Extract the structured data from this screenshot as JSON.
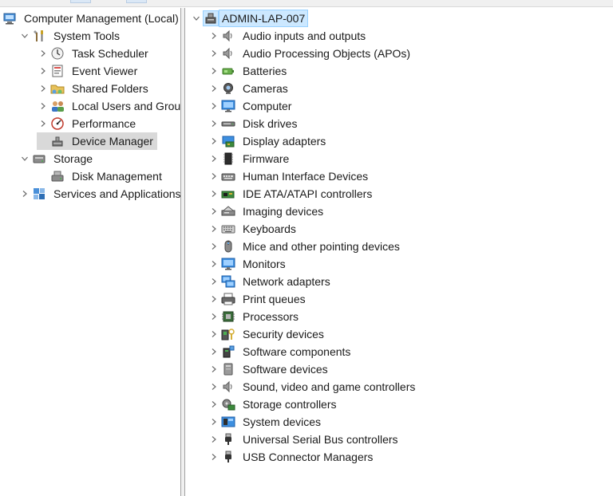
{
  "left_tree": [
    {
      "label": "Computer Management (Local)",
      "icon": "computer-management-icon",
      "depth": 0,
      "chevron": "none",
      "selected": false
    },
    {
      "label": "System Tools",
      "icon": "system-tools-icon",
      "depth": 1,
      "chevron": "down",
      "selected": false
    },
    {
      "label": "Task Scheduler",
      "icon": "clock-icon",
      "depth": 2,
      "chevron": "right",
      "selected": false
    },
    {
      "label": "Event Viewer",
      "icon": "event-log-icon",
      "depth": 2,
      "chevron": "right",
      "selected": false
    },
    {
      "label": "Shared Folders",
      "icon": "shared-folder-icon",
      "depth": 2,
      "chevron": "right",
      "selected": false
    },
    {
      "label": "Local Users and Groups",
      "icon": "users-icon",
      "depth": 2,
      "chevron": "right",
      "selected": false
    },
    {
      "label": "Performance",
      "icon": "performance-icon",
      "depth": 2,
      "chevron": "right",
      "selected": false
    },
    {
      "label": "Device Manager",
      "icon": "device-manager-icon",
      "depth": 2,
      "chevron": "none",
      "selected": true
    },
    {
      "label": "Storage",
      "icon": "storage-icon",
      "depth": 1,
      "chevron": "down",
      "selected": false
    },
    {
      "label": "Disk Management",
      "icon": "disk-management-icon",
      "depth": 2,
      "chevron": "none",
      "selected": false
    },
    {
      "label": "Services and Applications",
      "icon": "services-icon",
      "depth": 1,
      "chevron": "right",
      "selected": false
    }
  ],
  "device_tree": {
    "root": {
      "label": "ADMIN-LAP-007",
      "icon": "computer-root-icon"
    },
    "categories": [
      {
        "label": "Audio inputs and outputs",
        "icon": "speaker-icon"
      },
      {
        "label": "Audio Processing Objects (APOs)",
        "icon": "speaker-icon"
      },
      {
        "label": "Batteries",
        "icon": "battery-icon"
      },
      {
        "label": "Cameras",
        "icon": "camera-icon"
      },
      {
        "label": "Computer",
        "icon": "monitor-icon"
      },
      {
        "label": "Disk drives",
        "icon": "disk-drive-icon"
      },
      {
        "label": "Display adapters",
        "icon": "display-adapter-icon"
      },
      {
        "label": "Firmware",
        "icon": "firmware-icon"
      },
      {
        "label": "Human Interface Devices",
        "icon": "hid-icon"
      },
      {
        "label": "IDE ATA/ATAPI controllers",
        "icon": "ide-controller-icon"
      },
      {
        "label": "Imaging devices",
        "icon": "imaging-icon"
      },
      {
        "label": "Keyboards",
        "icon": "keyboard-icon"
      },
      {
        "label": "Mice and other pointing devices",
        "icon": "mouse-icon"
      },
      {
        "label": "Monitors",
        "icon": "monitor-icon"
      },
      {
        "label": "Network adapters",
        "icon": "network-icon"
      },
      {
        "label": "Print queues",
        "icon": "printer-icon"
      },
      {
        "label": "Processors",
        "icon": "processor-icon"
      },
      {
        "label": "Security devices",
        "icon": "security-icon"
      },
      {
        "label": "Software components",
        "icon": "software-component-icon"
      },
      {
        "label": "Software devices",
        "icon": "software-device-icon"
      },
      {
        "label": "Sound, video and game controllers",
        "icon": "speaker-icon"
      },
      {
        "label": "Storage controllers",
        "icon": "storage-controller-icon"
      },
      {
        "label": "System devices",
        "icon": "system-devices-icon"
      },
      {
        "label": "Universal Serial Bus controllers",
        "icon": "usb-icon"
      },
      {
        "label": "USB Connector Managers",
        "icon": "usb-icon"
      }
    ]
  },
  "colors": {
    "selection_gray": "#d9d9d9",
    "root_highlight": "#cce8ff",
    "root_highlight_border": "#99d1ff",
    "chevron": "#6b6b6b",
    "splitter": "#f0f0f0"
  }
}
